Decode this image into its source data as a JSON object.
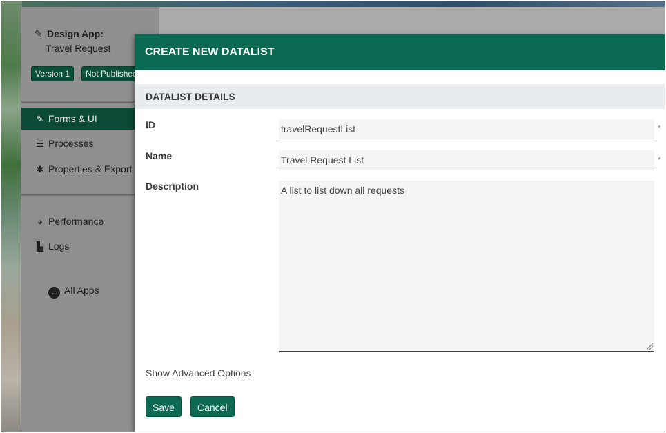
{
  "sidebar": {
    "app_title": "Design App:",
    "app_name": "Travel Request",
    "badges": [
      "Version 1",
      "Not Published"
    ],
    "nav": [
      {
        "label": "Forms & UI",
        "icon": "edit-icon"
      },
      {
        "label": "Processes",
        "icon": "list-icon"
      },
      {
        "label": "Properties & Export",
        "icon": "gear-icon"
      },
      {
        "label": "Performance",
        "icon": "dashboard-icon"
      },
      {
        "label": "Logs",
        "icon": "scroll-icon"
      }
    ],
    "all_apps": "All Apps"
  },
  "modal": {
    "title": "CREATE NEW DATALIST",
    "section": "DATALIST DETAILS",
    "fields": {
      "id": {
        "label": "ID",
        "value": "travelRequestList",
        "required": "*"
      },
      "name": {
        "label": "Name",
        "value": "Travel Request List",
        "required": "*"
      },
      "description": {
        "label": "Description",
        "value": "A list to list down all requests"
      }
    },
    "advanced_link": "Show Advanced Options",
    "save_label": "Save",
    "cancel_label": "Cancel"
  },
  "colors": {
    "primary": "#0a6b52",
    "dark_primary": "#0b4a36",
    "section_bg": "#e9ecef"
  }
}
